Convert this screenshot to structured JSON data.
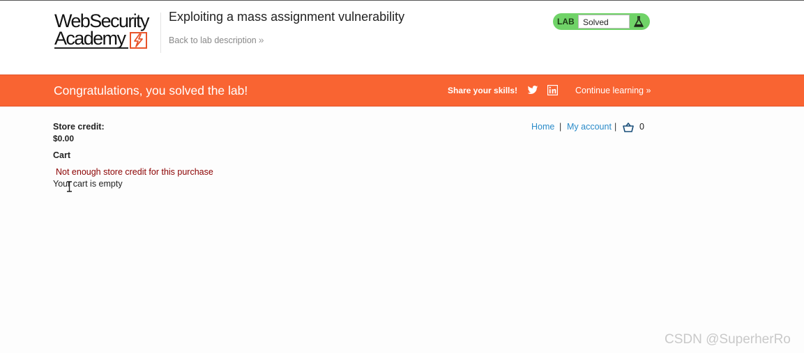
{
  "logo": {
    "line1": "WebSecurity",
    "line2": "Academy"
  },
  "header": {
    "lab_title": "Exploiting a mass assignment vulnerability",
    "back_link": "Back to lab description",
    "back_chevron": "»"
  },
  "status": {
    "lab_label": "LAB",
    "state": "Solved",
    "icon": "flask-icon"
  },
  "banner": {
    "message": "Congratulations, you solved the lab!",
    "share_label": "Share your skills!",
    "continue_label": "Continue learning",
    "continue_chevron": "»",
    "color": "#f96432"
  },
  "account": {
    "credit_label": "Store credit:",
    "credit_value": "$0.00",
    "cart_heading": "Cart",
    "error_message": "Not enough store credit for this purchase",
    "cart_empty_message": "Your cart is empty"
  },
  "nav": {
    "home": "Home",
    "separator": "|",
    "my_account": "My account",
    "cart_count": "0",
    "link_color": "#2a8bc9"
  },
  "watermark": "CSDN @SuperherRo"
}
